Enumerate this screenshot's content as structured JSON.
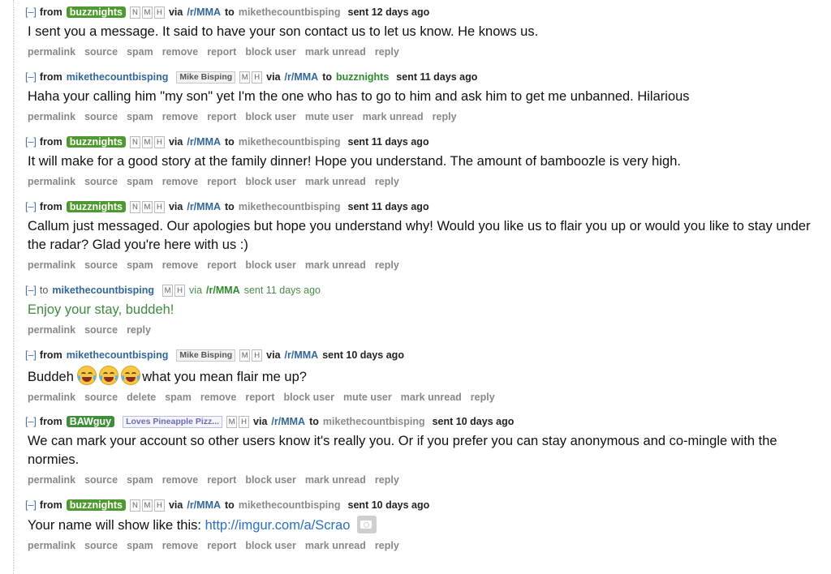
{
  "common": {
    "collapse": "[–]",
    "from": "from",
    "to": "to",
    "via": "via",
    "subreddit": "/r/MMA",
    "tag_n": "N",
    "tag_m": "M",
    "tag_h": "H"
  },
  "users": {
    "buzz": "buzznights",
    "mike": "mikethecountbisping",
    "baw": "BAWguy"
  },
  "flairs": {
    "mike": "Mike Bisping",
    "baw": "Loves Pineapple Pizz..."
  },
  "messages": [
    {
      "sent": "sent 12 days ago",
      "body": "I sent you a message. It said to have your son contact us to let us know. He knows us.",
      "actions": [
        "permalink",
        "source",
        "spam",
        "remove",
        "report",
        "block user",
        "mark unread",
        "reply"
      ]
    },
    {
      "sent": "sent 11 days ago",
      "body": "Haha your calling him \"my son\" yet I'm the one who has to go to him and ask him to get me unbanned. Hilarious",
      "actions": [
        "permalink",
        "source",
        "spam",
        "remove",
        "report",
        "block user",
        "mute user",
        "mark unread",
        "reply"
      ]
    },
    {
      "sent": "sent 11 days ago",
      "body": "It will make for a good story at the family dinner! Hope you understand. The amount of bamboozle is very high.",
      "actions": [
        "permalink",
        "source",
        "spam",
        "remove",
        "report",
        "block user",
        "mark unread",
        "reply"
      ]
    },
    {
      "sent": "sent 11 days ago",
      "body": "Callum just messaged. Our apologies but hope you understand why! Would you like us to flair you up or would you like to stay under the radar? Glad you're here with us :)",
      "actions": [
        "permalink",
        "source",
        "spam",
        "remove",
        "report",
        "block user",
        "mark unread",
        "reply"
      ]
    },
    {
      "sent": "sent 11 days ago",
      "body": "Enjoy your stay, buddeh!",
      "actions": [
        "permalink",
        "source",
        "reply"
      ]
    },
    {
      "sent": "sent 10 days ago",
      "body_pre": "Buddeh",
      "body_post": "what you mean flair me up?",
      "actions": [
        "permalink",
        "source",
        "delete",
        "spam",
        "remove",
        "report",
        "block user",
        "mute user",
        "mark unread",
        "reply"
      ]
    },
    {
      "sent": "sent 10 days ago",
      "body": "We can mark your account so other users know it's really you. Or if you prefer you can stay anonymous and co-mingle with the normies.",
      "actions": [
        "permalink",
        "source",
        "spam",
        "remove",
        "report",
        "block user",
        "mark unread",
        "reply"
      ]
    },
    {
      "sent": "sent 10 days ago",
      "body_pre": "Your name will show like this:",
      "link": "http://imgur.com/a/Scrao",
      "actions": [
        "permalink",
        "source",
        "spam",
        "remove",
        "report",
        "block user",
        "mark unread",
        "reply"
      ]
    }
  ]
}
